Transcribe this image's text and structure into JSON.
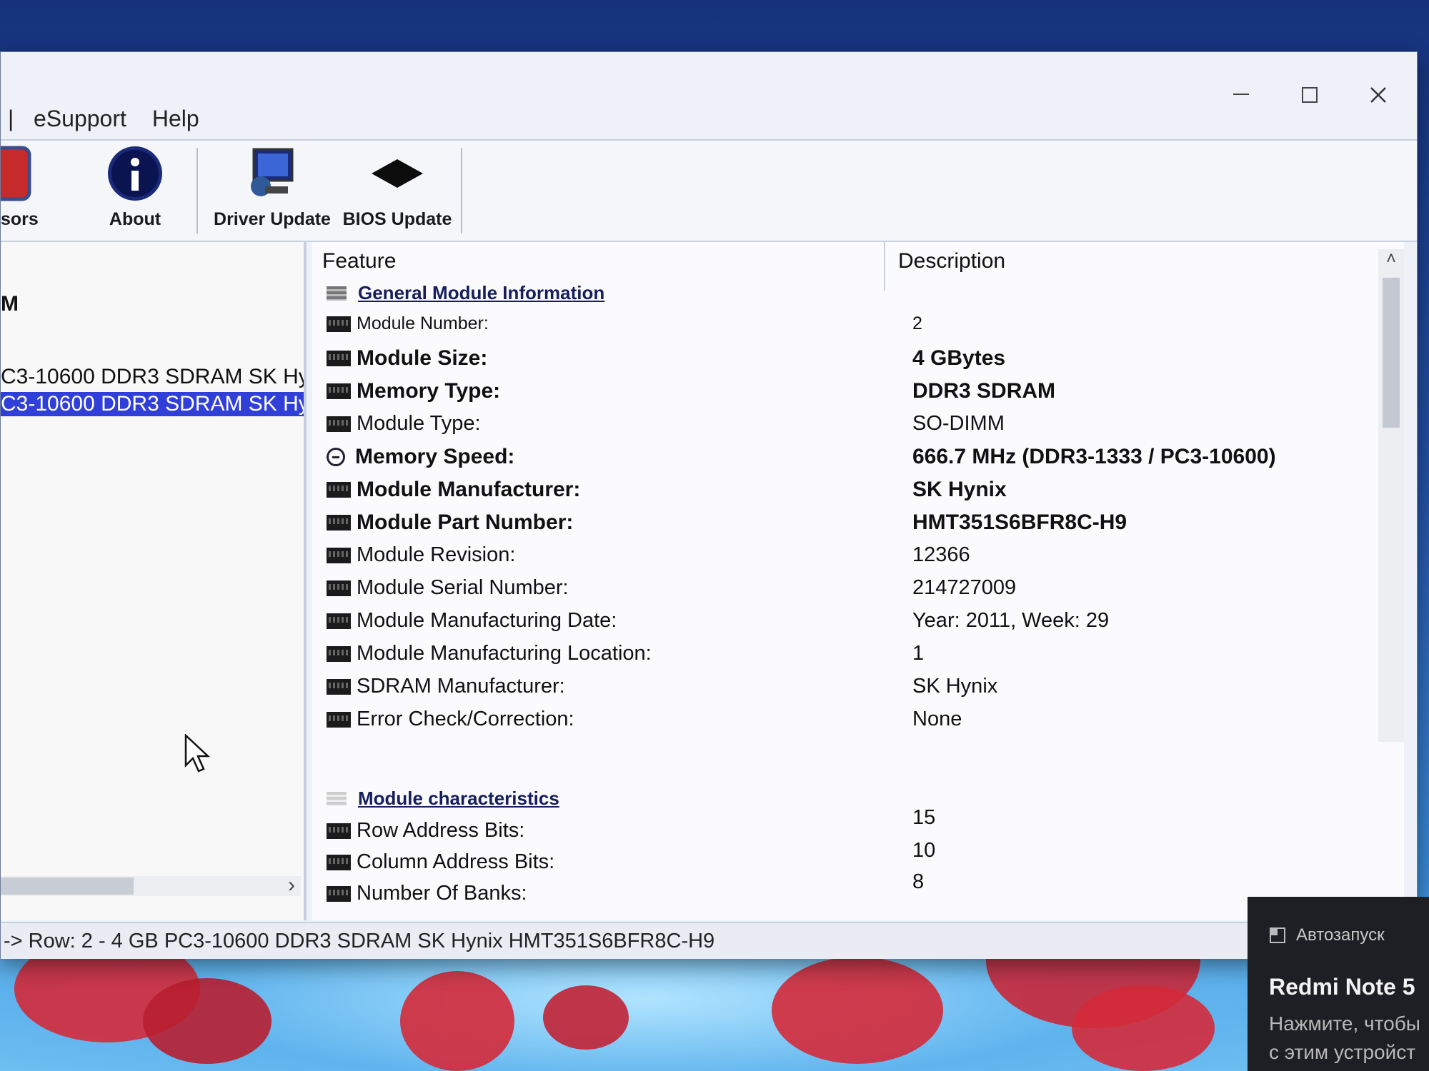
{
  "menu": {
    "items": [
      "eSupport",
      "Help"
    ]
  },
  "toolbar": {
    "sensors_label_partial": "sors",
    "about_label": "About",
    "driver_update_label": "Driver Update",
    "bios_update_label": "BIOS Update"
  },
  "tree": {
    "partial_item": "M",
    "item_module_1": "C3-10600 DDR3 SDRAM SK Hy",
    "item_module_2": "C3-10600 DDR3 SDRAM SK Hy"
  },
  "table": {
    "columns": [
      "Feature",
      "Description"
    ],
    "section_general": "General Module Information",
    "section_characteristics": "Module characteristics",
    "rows": [
      {
        "feature": "Module Number:",
        "value": "2"
      },
      {
        "feature": "Module Size:",
        "value": "4 GBytes"
      },
      {
        "feature": "Memory Type:",
        "value": "DDR3 SDRAM"
      },
      {
        "feature": "Module Type:",
        "value": "SO-DIMM"
      },
      {
        "feature": "Memory Speed:",
        "value": "666.7 MHz (DDR3-1333 / PC3-10600)"
      },
      {
        "feature": "Module Manufacturer:",
        "value": "SK Hynix"
      },
      {
        "feature": "Module Part Number:",
        "value": "HMT351S6BFR8C-H9"
      },
      {
        "feature": "Module Revision:",
        "value": "12366"
      },
      {
        "feature": "Module Serial Number:",
        "value": "214727009"
      },
      {
        "feature": "Module Manufacturing Date:",
        "value": "Year: 2011, Week: 29"
      },
      {
        "feature": "Module Manufacturing Location:",
        "value": "1"
      },
      {
        "feature": "SDRAM Manufacturer:",
        "value": "SK Hynix"
      },
      {
        "feature": "Error Check/Correction:",
        "value": "None"
      }
    ],
    "char_rows": [
      {
        "feature": "Row Address Bits:",
        "value": "15"
      },
      {
        "feature": "Column Address Bits:",
        "value": "10"
      },
      {
        "feature": "Number Of Banks:",
        "value": "8"
      }
    ]
  },
  "statusbar": {
    "text": "-> Row: 2 - 4 GB PC3-10600 DDR3 SDRAM SK Hynix HMT351S6BFR8C-H9"
  },
  "toast": {
    "header": "Автозапуск",
    "title": "Redmi Note 5",
    "body_line1": "Нажмите, чтобы",
    "body_line2": "с этим устройст"
  }
}
